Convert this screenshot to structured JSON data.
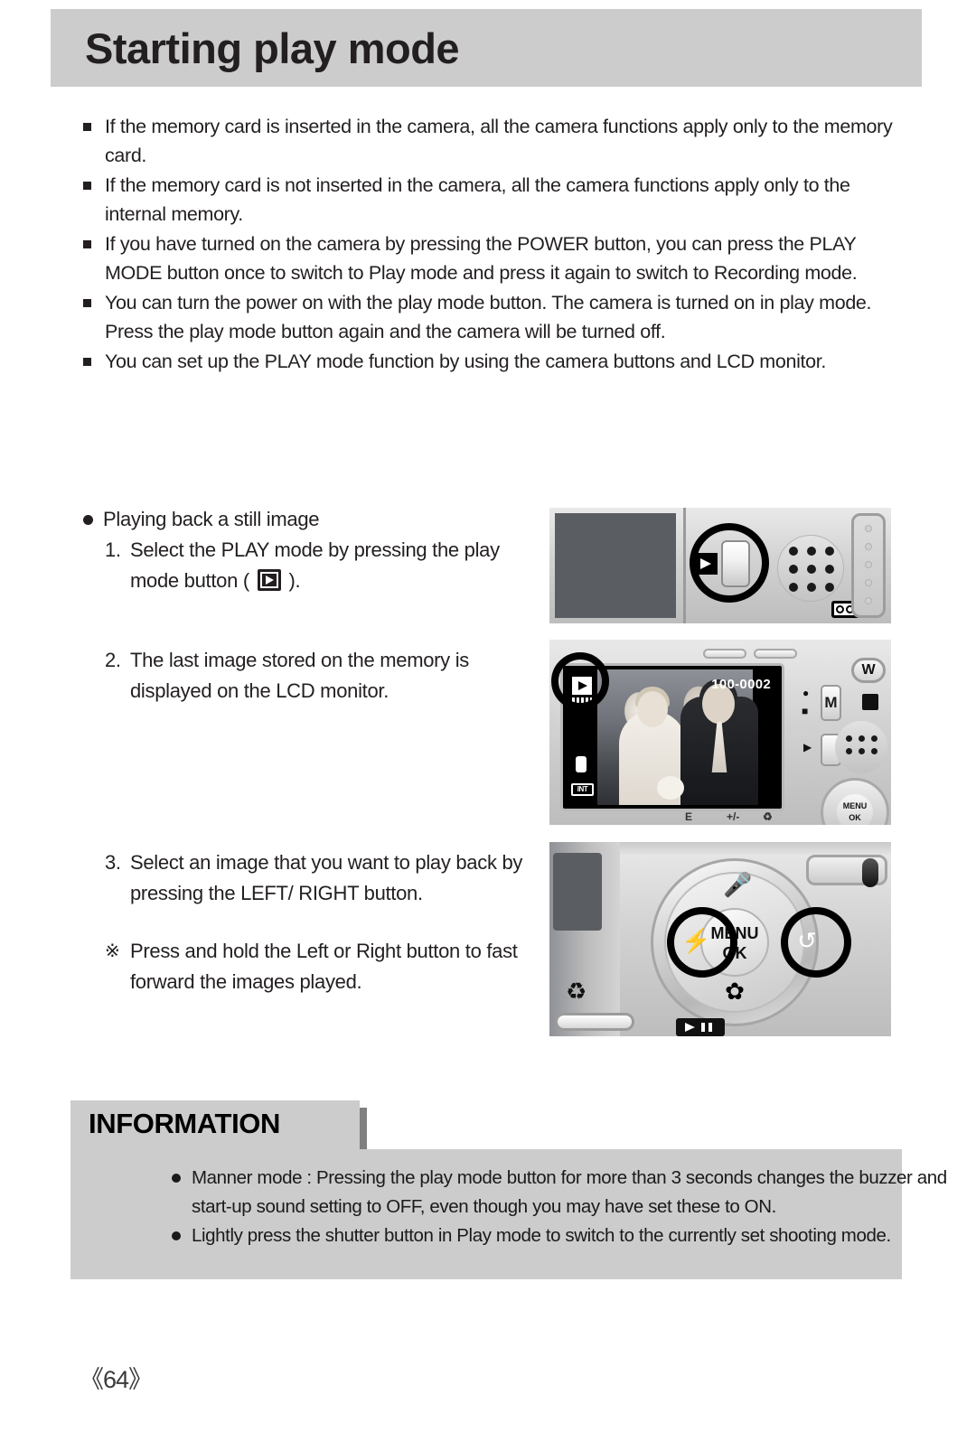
{
  "header": {
    "title": "Starting play mode",
    "bar_color": "#cccccc"
  },
  "notes": [
    "If the memory card is inserted in the camera, all the camera functions apply only to the memory card.",
    "If the memory card is not inserted in the camera, all the camera functions apply only to the internal memory.",
    "If you have turned on the camera by pressing the POWER button, you can press the PLAY MODE button once to switch to Play mode and press it again to switch to Recording mode.",
    "You can turn the power on with the play mode button. The camera is turned on in play mode. Press the play mode button again and the camera will be turned off.",
    "You can set up the PLAY mode function by using the camera buttons and LCD monitor."
  ],
  "procedure": {
    "heading": "Playing back a still image",
    "steps": [
      {
        "num": "1.",
        "text_before": "Select the PLAY mode by pressing the play mode button ( ",
        "text_after": " )."
      },
      {
        "num": "2.",
        "text": "The last image stored on the memory is displayed on the LCD monitor."
      },
      {
        "num": "3.",
        "text": "Select an image that you want to play back by pressing the LEFT/ RIGHT button."
      }
    ],
    "note": {
      "mark": "※",
      "text": "Press and hold the Left or Right button to fast forward the images played."
    }
  },
  "photos": {
    "panel_top": {
      "play_mode_icon": "play-icon",
      "voice_memo_icon": "voice-memo-icon"
    },
    "panel_lcd": {
      "file_number": "100-0002",
      "osd_icons": [
        "play-icon",
        "battery-icon",
        "memory-card-icon",
        "INT"
      ],
      "int_label": "INT",
      "mode_button_label": "M",
      "wide_button_label": "W",
      "menu_ok_line1": "MENU",
      "menu_ok_line2": "OK"
    },
    "panel_pad": {
      "menu_ok_line1": "MENU",
      "menu_ok_line2": "OK",
      "up_icon": "microphone-icon",
      "down_icon": "macro-flower-icon",
      "left_icon": "flash-icon",
      "right_icon": "self-timer-icon",
      "delete_icon": "delete-trash-icon",
      "play-pause_icon": "play-pause-icon"
    }
  },
  "information": {
    "tab_label": "INFORMATION",
    "items": [
      "Manner mode : Pressing the play mode button for more than 3 seconds changes the buzzer and start-up sound setting to OFF, even though you may have set these to ON.",
      "Lightly press the shutter button in Play mode to switch to the currently set shooting mode."
    ],
    "box_color": "#cccccc"
  },
  "footer": {
    "page_number": "《64》"
  }
}
